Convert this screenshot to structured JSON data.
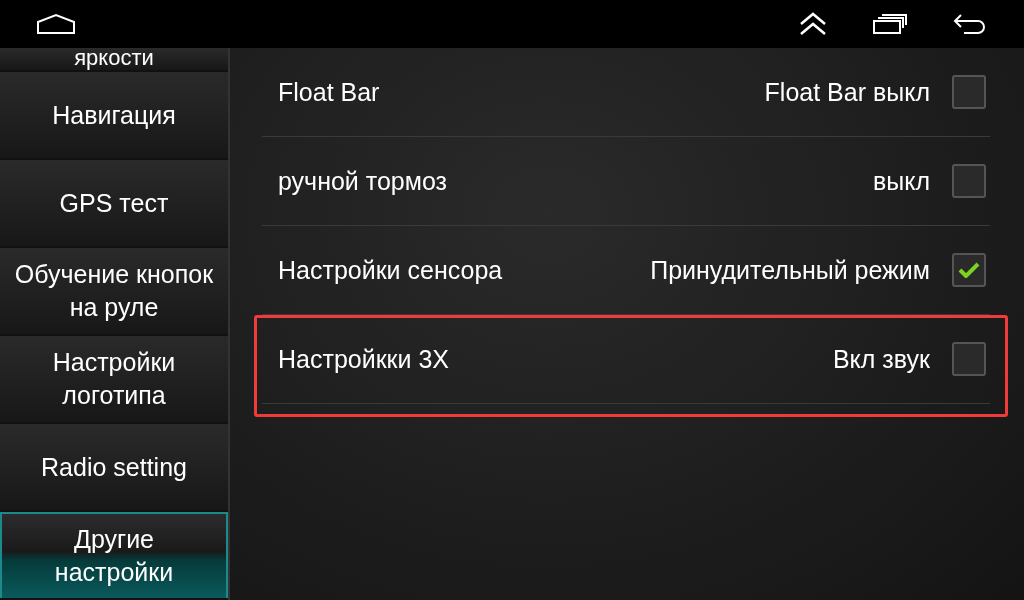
{
  "sidebar": {
    "items": [
      {
        "label": "яркости",
        "selected": false
      },
      {
        "label": "Навигация",
        "selected": false
      },
      {
        "label": "GPS тест",
        "selected": false
      },
      {
        "label": "Обучение кнопок на руле",
        "selected": false
      },
      {
        "label": "Настройки логотипа",
        "selected": false
      },
      {
        "label": "Radio setting",
        "selected": false
      },
      {
        "label": "Другие настройки",
        "selected": true
      }
    ]
  },
  "settings": [
    {
      "label": "Float Bar",
      "value": "Float Bar выкл",
      "checked": false,
      "highlighted": false
    },
    {
      "label": "ручной тормоз",
      "value": "выкл",
      "checked": false,
      "highlighted": false
    },
    {
      "label": "Настройки сенсора",
      "value": "Принудительный режим",
      "checked": true,
      "highlighted": false
    },
    {
      "label": "Настройкки 3X",
      "value": "Вкл звук",
      "checked": false,
      "highlighted": true
    }
  ]
}
